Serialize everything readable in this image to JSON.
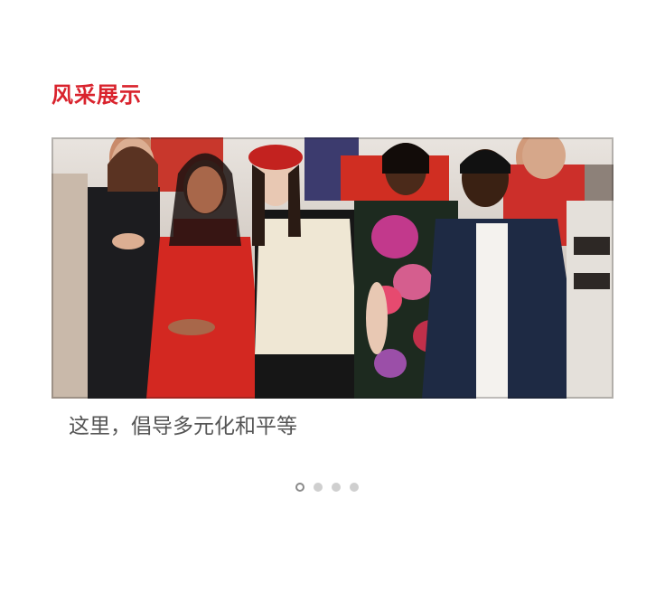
{
  "section": {
    "title": "风采展示"
  },
  "carousel": {
    "active_index": 0,
    "slide_count": 4,
    "slides": [
      {
        "caption": "这里，倡导多元化和平等",
        "image": "group-photo"
      }
    ]
  },
  "colors": {
    "accent": "#d9232d",
    "caption": "#555555",
    "dot": "#cfcfcf",
    "dot_active_border": "#8a8a8a"
  }
}
